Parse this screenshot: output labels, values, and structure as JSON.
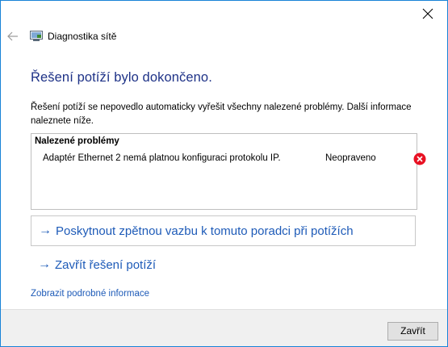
{
  "window": {
    "title": "Diagnostika sítě",
    "accent": "#1883d7"
  },
  "main": {
    "heading": "Řešení potíží bylo dokončeno.",
    "description": "Řešení potíží se nepovedlo automaticky vyřešit všechny nalezené problémy. Další informace naleznete níže.",
    "problems": {
      "title": "Nalezené problémy",
      "items": [
        {
          "text": "Adaptér Ethernet 2 nemá platnou konfiguraci protokolu IP.",
          "status": "Neopraveno",
          "icon": "error-icon"
        }
      ]
    },
    "links": {
      "feedback": "Poskytnout zpětnou vazbu k tomuto poradci při potížích",
      "close_troubleshooter": "Zavřít řešení potíží",
      "details": "Zobrazit podrobné informace",
      "arrow": "→"
    }
  },
  "footer": {
    "close_button": "Zavřít"
  },
  "colors": {
    "heading": "#1e3287",
    "link": "#1e5bb8",
    "error": "#e81123"
  }
}
